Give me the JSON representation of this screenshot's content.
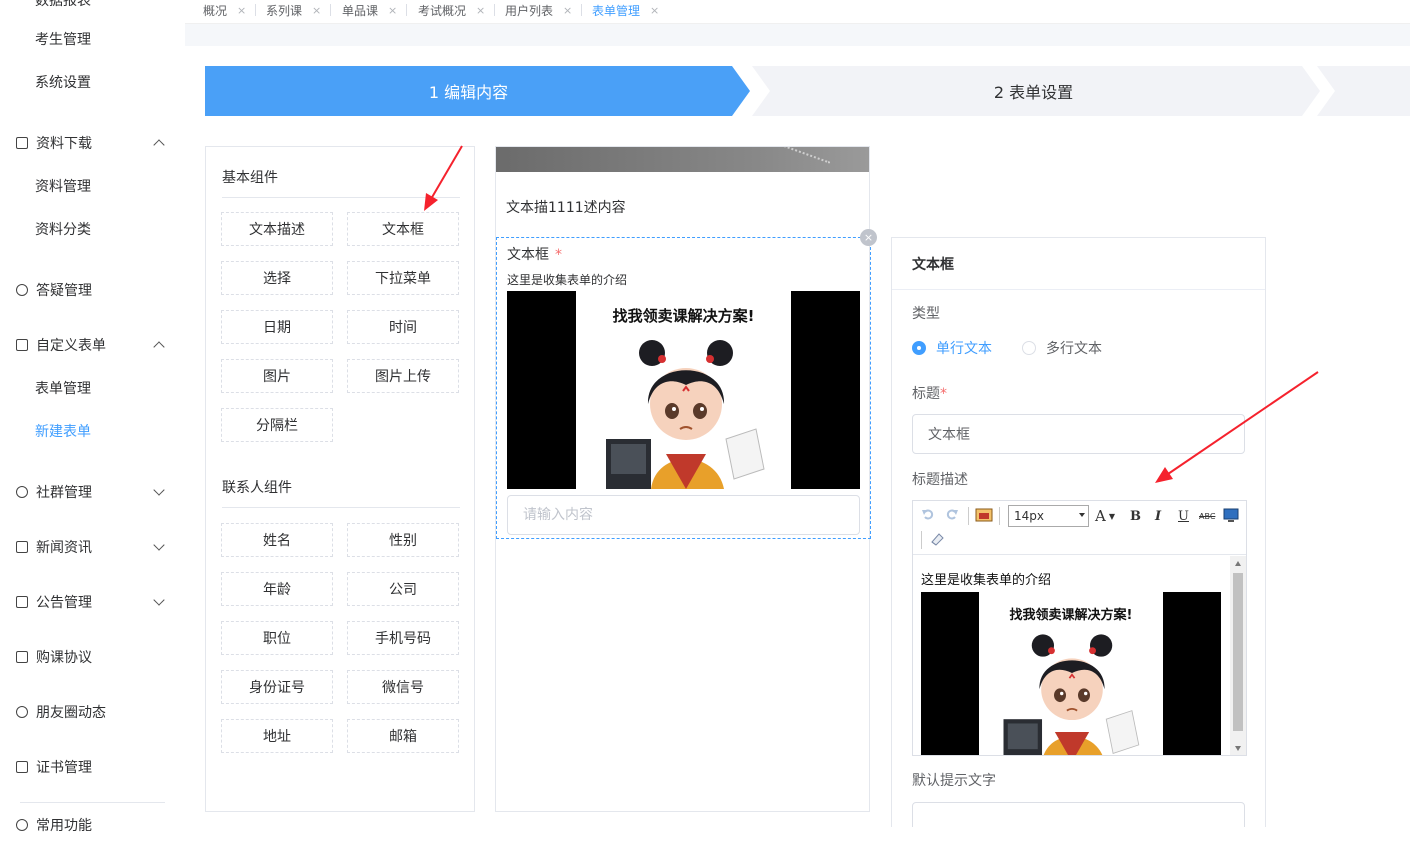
{
  "sidebar": {
    "items": [
      {
        "label": "数据报表",
        "type": "sub"
      },
      {
        "label": "考生管理",
        "type": "sub"
      },
      {
        "label": "系统设置",
        "type": "sub"
      },
      {
        "label": "资料下载",
        "type": "parent",
        "icon": "download-doc-icon",
        "expanded": true
      },
      {
        "label": "资料管理",
        "type": "sub"
      },
      {
        "label": "资料分类",
        "type": "sub"
      },
      {
        "label": "答疑管理",
        "type": "parent",
        "icon": "qa-icon"
      },
      {
        "label": "自定义表单",
        "type": "parent",
        "icon": "edit-form-icon",
        "expanded": true
      },
      {
        "label": "表单管理",
        "type": "sub"
      },
      {
        "label": "新建表单",
        "type": "sub",
        "active": true
      },
      {
        "label": "社群管理",
        "type": "parent",
        "icon": "users-icon",
        "expanded": false
      },
      {
        "label": "新闻资讯",
        "type": "parent",
        "icon": "news-icon",
        "expanded": false
      },
      {
        "label": "公告管理",
        "type": "parent",
        "icon": "notice-icon",
        "expanded": false
      },
      {
        "label": "购课协议",
        "type": "parent",
        "icon": "agreement-icon"
      },
      {
        "label": "朋友圈动态",
        "type": "parent",
        "icon": "moments-icon"
      },
      {
        "label": "证书管理",
        "type": "parent",
        "icon": "certificate-icon"
      },
      {
        "label": "常用功能",
        "type": "parent",
        "icon": "apps-icon"
      }
    ]
  },
  "tabs": [
    {
      "label": "概况"
    },
    {
      "label": "系列课"
    },
    {
      "label": "单品课"
    },
    {
      "label": "考试概况"
    },
    {
      "label": "用户列表"
    },
    {
      "label": "表单管理",
      "active": true
    }
  ],
  "tab_close_glyph": "×",
  "steps": [
    {
      "label": "1 编辑内容",
      "active": true
    },
    {
      "label": "2 表单设置",
      "active": false
    }
  ],
  "components": {
    "basic_title": "基本组件",
    "basic": [
      "文本描述",
      "文本框",
      "选择",
      "下拉菜单",
      "日期",
      "时间",
      "图片",
      "图片上传",
      "分隔栏"
    ],
    "contact_title": "联系人组件",
    "contact": [
      "姓名",
      "性别",
      "年龄",
      "公司",
      "职位",
      "手机号码",
      "身份证号",
      "微信号",
      "地址",
      "邮箱"
    ]
  },
  "preview": {
    "description": "文本描1111述内容",
    "field_label": "文本框",
    "required_mark": "*",
    "intro": "这里是收集表单的介绍",
    "poster_headline": "找我领卖课解决方案!",
    "input_placeholder": "请输入内容",
    "close_glyph": "×"
  },
  "settings": {
    "header": "文本框",
    "type_label": "类型",
    "type_options": [
      {
        "label": "单行文本",
        "checked": true
      },
      {
        "label": "多行文本",
        "checked": false
      }
    ],
    "title_label": "标题",
    "title_required": "*",
    "title_value": "文本框",
    "desc_label": "标题描述",
    "editor": {
      "font_size": "14px",
      "intro": "这里是收集表单的介绍",
      "poster_headline": "找我领卖课解决方案!",
      "tools": {
        "font_color": "A",
        "bold": "B",
        "italic": "I",
        "underline": "U",
        "strike": "ABC"
      }
    },
    "default_label": "默认提示文字"
  },
  "colors": {
    "accent": "#409eff",
    "step_inactive": "#f2f3f7",
    "annotation_arrow": "#f5222d"
  }
}
